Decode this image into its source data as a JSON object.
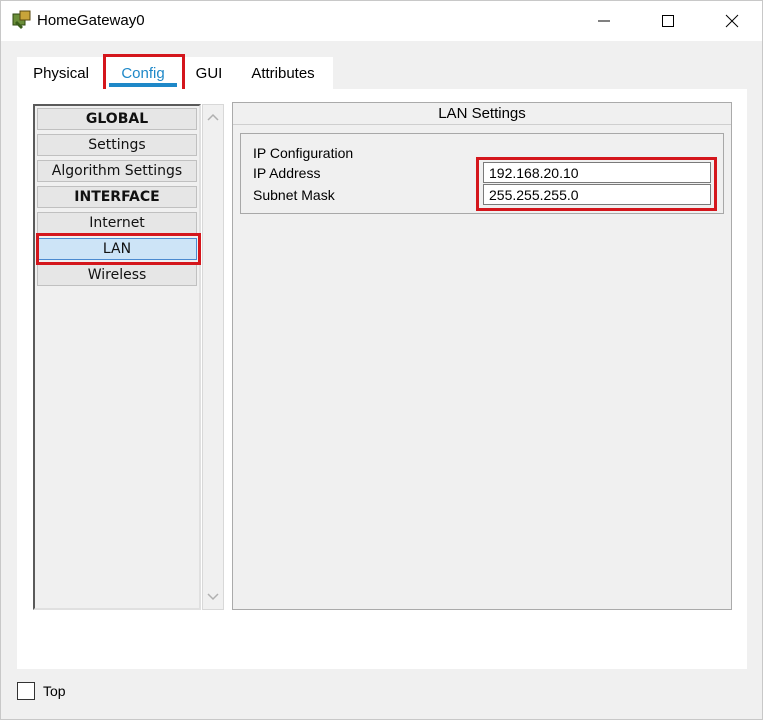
{
  "window": {
    "title": "HomeGateway0"
  },
  "tabs": [
    {
      "label": "Physical"
    },
    {
      "label": "Config"
    },
    {
      "label": "GUI"
    },
    {
      "label": "Attributes"
    }
  ],
  "sidebar": {
    "items": [
      {
        "label": "GLOBAL"
      },
      {
        "label": "Settings"
      },
      {
        "label": "Algorithm Settings"
      },
      {
        "label": "INTERFACE"
      },
      {
        "label": "Internet"
      },
      {
        "label": "LAN"
      },
      {
        "label": "Wireless"
      }
    ]
  },
  "panel": {
    "title": "LAN Settings",
    "section_label": "IP Configuration",
    "ip_label": "IP Address",
    "ip_value": "192.168.20.10",
    "mask_label": "Subnet Mask",
    "mask_value": "255.255.255.0"
  },
  "footer": {
    "top_label": "Top"
  },
  "colors": {
    "accent": "#1e88c8",
    "highlight": "#d4161c",
    "selected": "#cde4f7"
  }
}
